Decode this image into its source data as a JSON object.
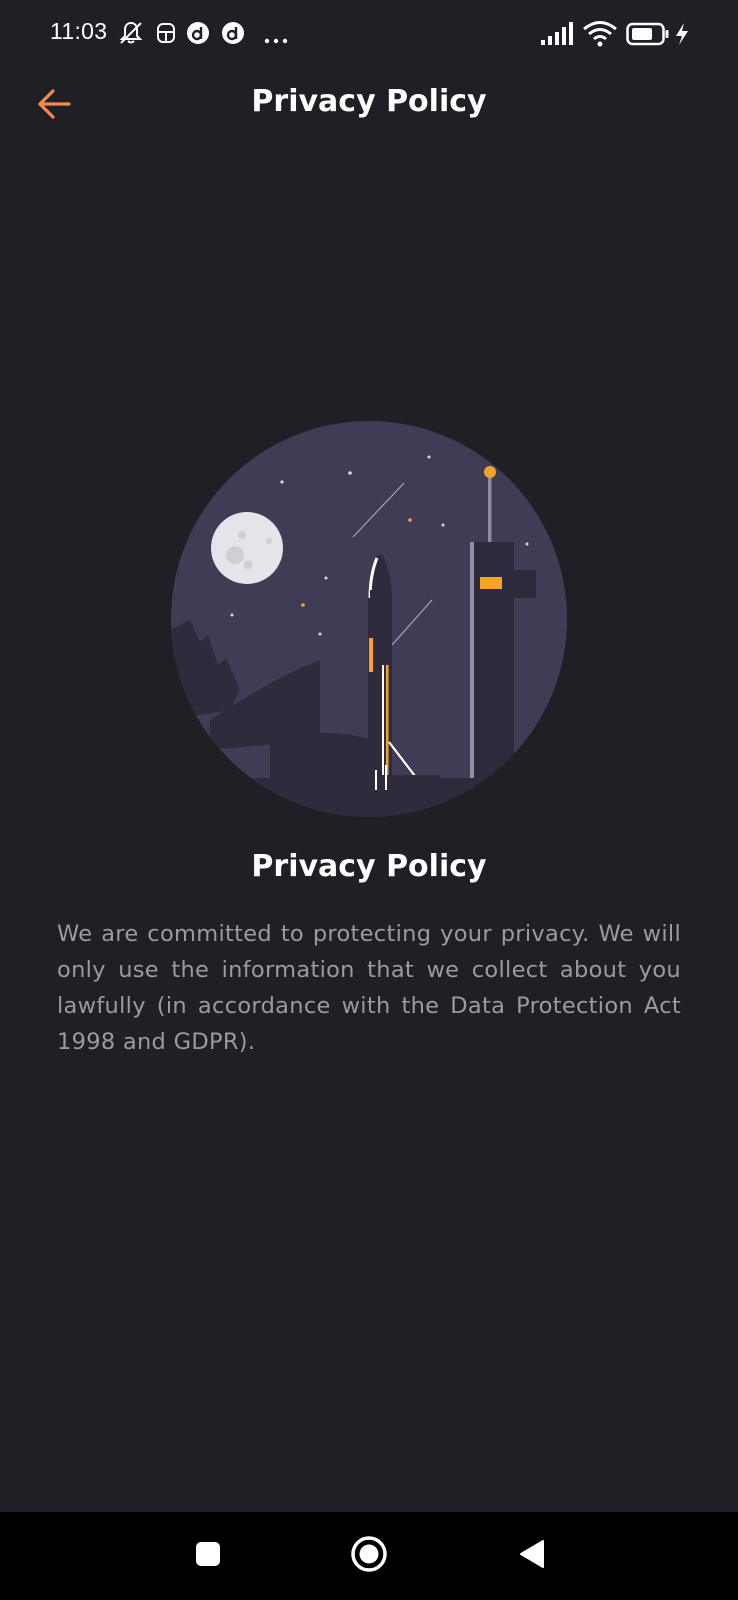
{
  "status_bar": {
    "time": "11:03",
    "icons": [
      "bell-off-icon",
      "notification-app-icon",
      "d-app-icon",
      "d-app-icon",
      "more-dots-icon",
      "signal-icon",
      "wifi-icon",
      "battery-icon",
      "charging-icon"
    ]
  },
  "header": {
    "title": "Privacy Policy",
    "back_icon": "back-arrow-icon"
  },
  "illustration": {
    "name": "rocket-launch-night-illustration"
  },
  "content": {
    "title": "Privacy Policy",
    "body": "We are committed to protecting your privacy. We will only use the information that we collect about you lawfully (in accordance with the Data Protection Act 1998 and GDPR)."
  },
  "nav_bar": {
    "icons": [
      "recent-apps-icon",
      "home-icon",
      "back-icon"
    ]
  },
  "colors": {
    "background": "#1f2025",
    "accent": "#f5894f",
    "body_text": "#9a9aa2",
    "illustration_circle": "#3f3d55",
    "rocket_orange": "#f3a52a"
  }
}
